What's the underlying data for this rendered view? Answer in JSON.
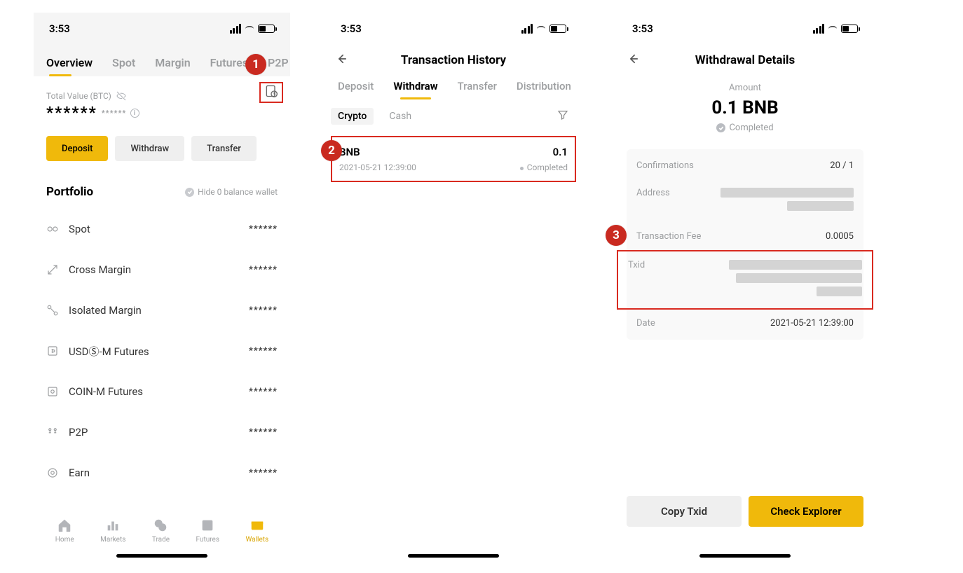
{
  "status_time": "3:53",
  "screen1": {
    "tabs": [
      "Overview",
      "Spot",
      "Margin",
      "Futures",
      "P2P"
    ],
    "total_label": "Total Value (BTC)",
    "total_main": "******",
    "total_sub": "******",
    "deposit": "Deposit",
    "withdraw": "Withdraw",
    "transfer": "Transfer",
    "portfolio_title": "Portfolio",
    "hide0": "Hide 0 balance wallet",
    "rows": [
      {
        "label": "Spot",
        "val": "******"
      },
      {
        "label": "Cross Margin",
        "val": "******"
      },
      {
        "label": "Isolated Margin",
        "val": "******"
      },
      {
        "label": "USDⓈ-M Futures",
        "val": "******"
      },
      {
        "label": "COIN-M Futures",
        "val": "******"
      },
      {
        "label": "P2P",
        "val": "******"
      },
      {
        "label": "Earn",
        "val": "******"
      }
    ],
    "nav": [
      "Home",
      "Markets",
      "Trade",
      "Futures",
      "Wallets"
    ]
  },
  "screen2": {
    "title": "Transaction History",
    "tabs": [
      "Deposit",
      "Withdraw",
      "Transfer",
      "Distribution"
    ],
    "subtabs": [
      "Crypto",
      "Cash"
    ],
    "tx": {
      "asset": "BNB",
      "amt": "0.1",
      "time": "2021-05-21 12:39:00",
      "status": "Completed"
    }
  },
  "screen3": {
    "title": "Withdrawal Details",
    "amount_label": "Amount",
    "amount": "0.1 BNB",
    "status": "Completed",
    "rows": {
      "confirmations_k": "Confirmations",
      "confirmations_v": "20 / 1",
      "address_k": "Address",
      "fee_k": "Transaction Fee",
      "fee_v": "0.0005",
      "txid_k": "Txid",
      "date_k": "Date",
      "date_v": "2021-05-21 12:39:00"
    },
    "copy": "Copy Txid",
    "explorer": "Check Explorer"
  },
  "badges": {
    "b1": "1",
    "b2": "2",
    "b3": "3"
  }
}
